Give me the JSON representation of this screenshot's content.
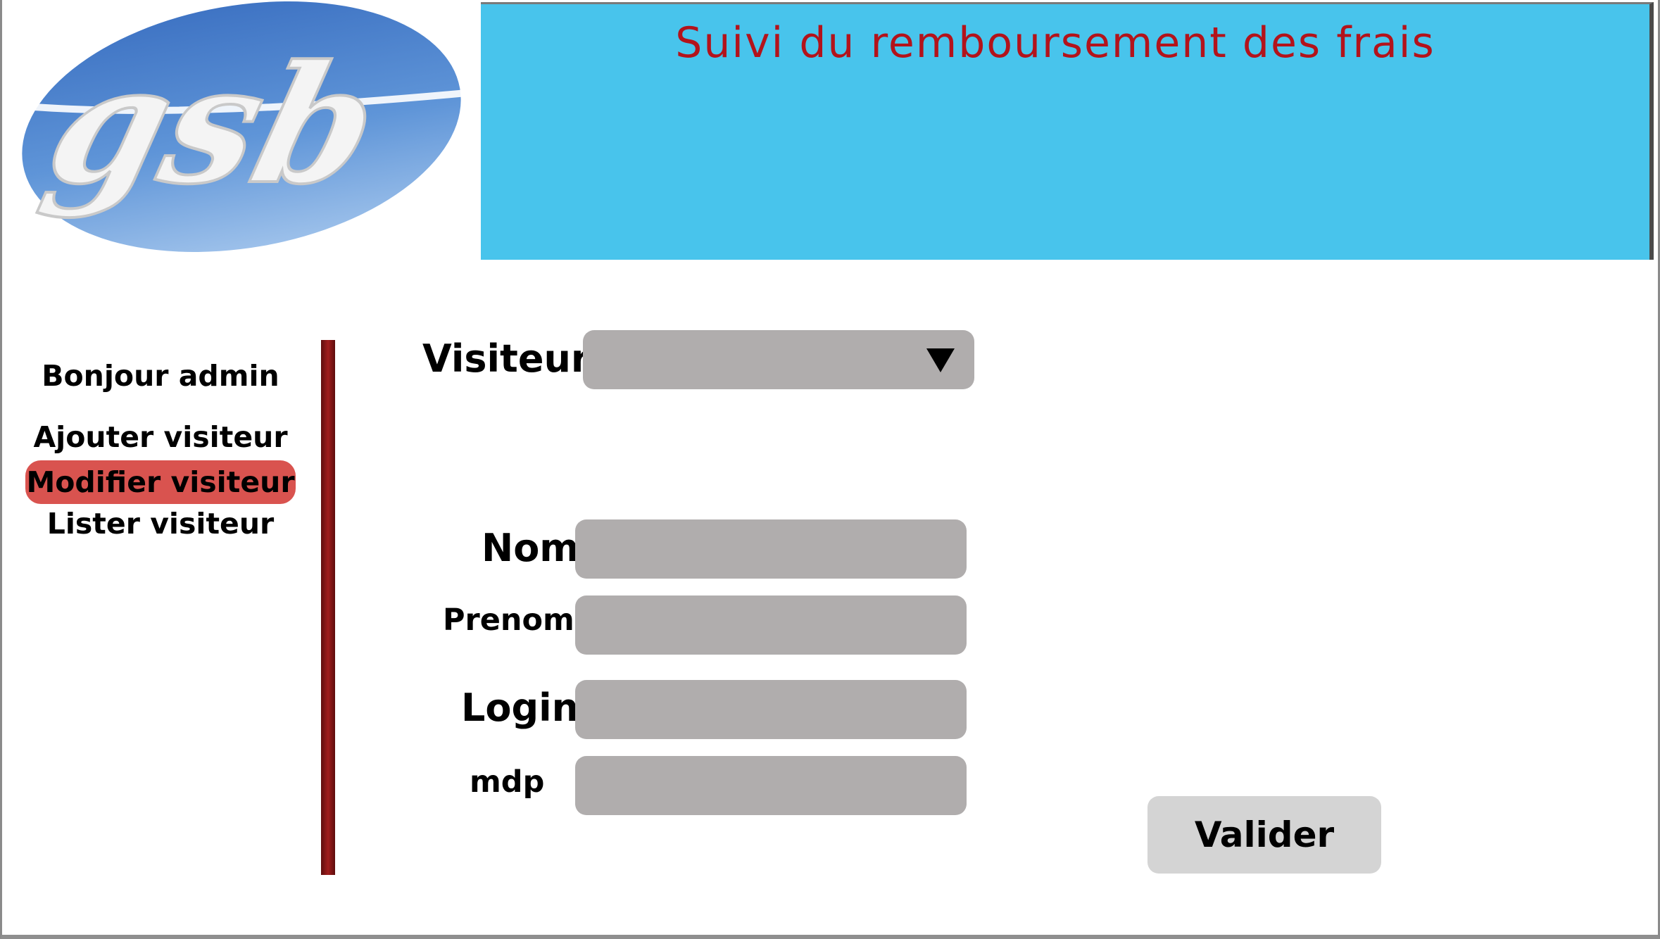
{
  "header": {
    "logo_text": "gsb",
    "title": "Suivi du remboursement des frais"
  },
  "sidebar": {
    "greeting": "Bonjour admin",
    "items": [
      {
        "label": "Ajouter visiteur",
        "active": false
      },
      {
        "label": "Modifier visiteur",
        "active": true
      },
      {
        "label": "Lister visiteur",
        "active": false
      }
    ]
  },
  "form": {
    "visiteur_label": "Visiteur",
    "visiteur_value": "",
    "nom_label": "Nom",
    "nom_value": "",
    "prenom_label": "Prenom",
    "prenom_value": "",
    "login_label": "Login",
    "login_value": "",
    "mdp_label": "mdp",
    "mdp_value": "",
    "submit_label": "Valider"
  },
  "colors": {
    "banner": "#48c4ec",
    "title": "#b3131b",
    "active_nav": "#d9534f",
    "field": "#b0adad",
    "divider": "#8b1a1a"
  },
  "icons": {
    "logo": "gsb-logo",
    "dropdown": "triangle-down-icon"
  }
}
